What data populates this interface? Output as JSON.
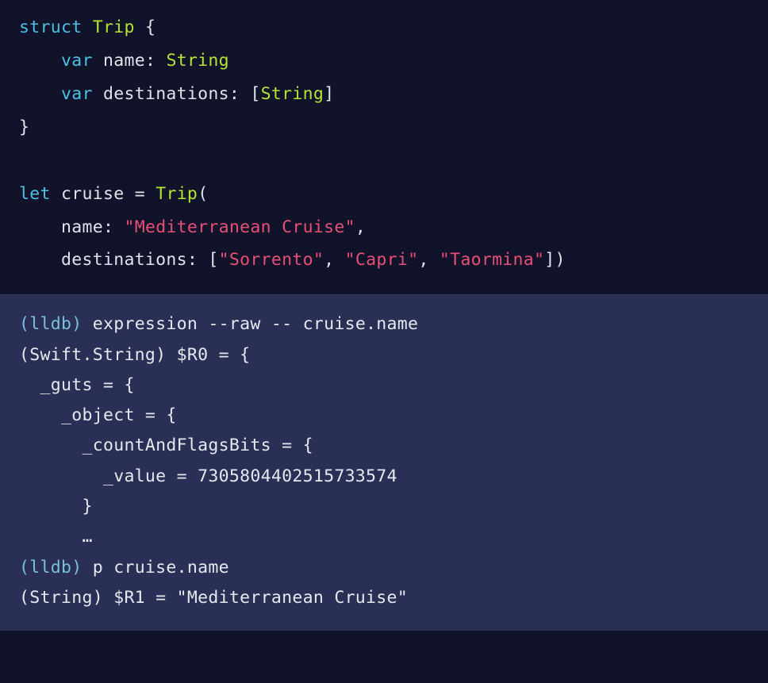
{
  "code": {
    "struct_kw": "struct",
    "struct_name": "Trip",
    "open_brace": "{",
    "var_kw1": "var",
    "field1_name": "name",
    "colon": ":",
    "field1_type": "String",
    "var_kw2": "var",
    "field2_name": "destinations",
    "field2_type_open": "[",
    "field2_type_inner": "String",
    "field2_type_close": "]",
    "close_brace": "}",
    "let_kw": "let",
    "var_cruise": "cruise",
    "equals": "=",
    "type_trip": "Trip",
    "paren_open": "(",
    "arg1_label": "name:",
    "arg1_value": "\"Mediterranean Cruise\"",
    "comma": ",",
    "arg2_label": "destinations:",
    "arr_open": "[",
    "dest1": "\"Sorrento\"",
    "dest2": "\"Capri\"",
    "dest3": "\"Taormina\"",
    "arr_close": "]",
    "paren_close": ")"
  },
  "lldb": {
    "prompt": "(lldb)",
    "cmd1": " expression --raw -- cruise.name",
    "out1": "(Swift.String) $R0 = {",
    "out2": "  _guts = {",
    "out3": "    _object = {",
    "out4": "      _countAndFlagsBits = {",
    "out5": "        _value = 7305804402515733574",
    "out6": "      }",
    "out7": "      …",
    "cmd2": " p cruise.name",
    "out8": "(String) $R1 = \"Mediterranean Cruise\""
  }
}
